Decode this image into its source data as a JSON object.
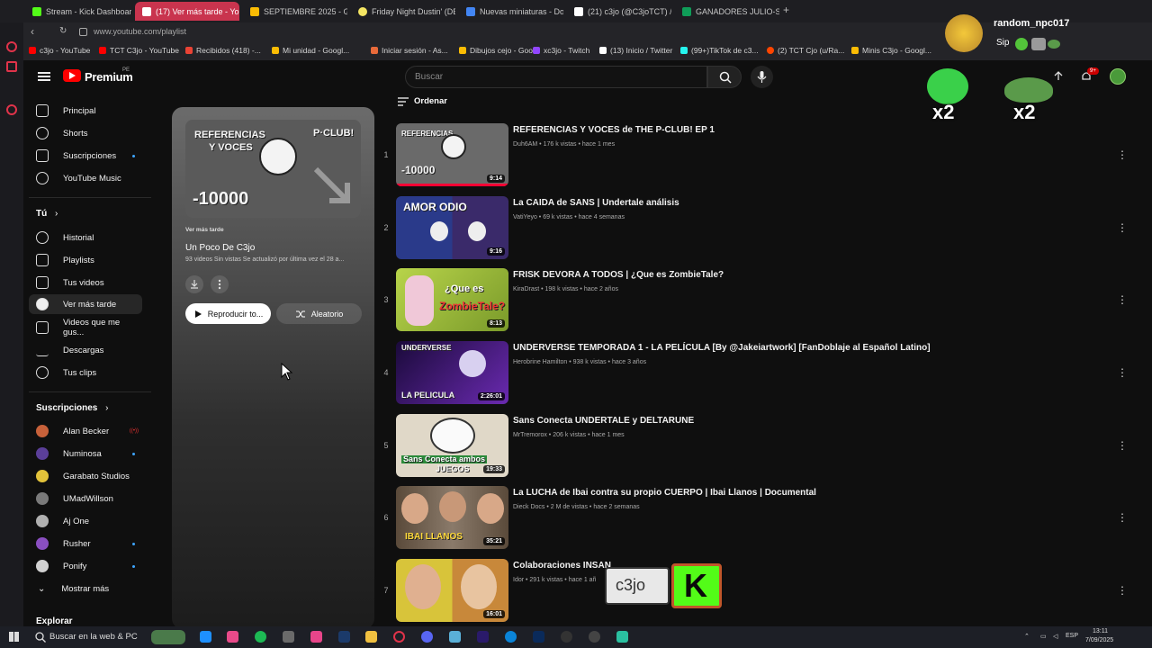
{
  "browser": {
    "tabs": [
      {
        "label": "Stream - Kick Dashboard",
        "color": "#53fc18"
      },
      {
        "label": "(17) Ver más tarde - YouT",
        "color": "#ffffff",
        "active": true
      },
      {
        "label": "SEPTIEMBRE 2025 - Goo",
        "color": "#fbbc04"
      },
      {
        "label": "Friday Night Dustin' (DEM",
        "color": "#f5e663"
      },
      {
        "label": "Nuevas miniaturas - Docu",
        "color": "#4285f4"
      },
      {
        "label": "(21) c3jo (@C3joTCT) / X",
        "color": "#ffffff"
      },
      {
        "label": "GANADORES JULIO-SET",
        "color": "#0f9d58"
      }
    ],
    "new_tab": "+",
    "address": "www.youtube.com/playlist",
    "bookmarks": [
      "c3jo - YouTube",
      "TCT C3jo - YouTube",
      "Recibidos (418) -...",
      "Mi unidad - Googl...",
      "Iniciar sesión - As...",
      "Dibujos cejo - Goo...",
      "xc3jo - Twitch",
      "(13) Inicio / Twitter",
      "(99+)TikTok de c3...",
      "(2) TCT Cjo (u/Ra...",
      "Minis C3jo - Googl..."
    ]
  },
  "youtube": {
    "brand": "Premium",
    "country": "PE",
    "search_placeholder": "Buscar",
    "sidebar": {
      "main": [
        "Principal",
        "Shorts",
        "Suscripciones",
        "YouTube Music"
      ],
      "you_heading": "Tú",
      "you": [
        "Historial",
        "Playlists",
        "Tus videos",
        "Ver más tarde",
        "Videos que me gus...",
        "Descargas",
        "Tus clips"
      ],
      "subs_heading": "Suscripciones",
      "subs": [
        {
          "name": "Alan Becker",
          "color": "#c7613a",
          "badge": "live"
        },
        {
          "name": "Numinosa",
          "color": "#5b3f99",
          "badge": "dot"
        },
        {
          "name": "Garabato Studios",
          "color": "#e2c23a",
          "badge": ""
        },
        {
          "name": "UMadWillson",
          "color": "#7a7a7a",
          "badge": ""
        },
        {
          "name": "Aj One",
          "color": "#b0b0b0",
          "badge": ""
        },
        {
          "name": "Rusher",
          "color": "#8a4fc1",
          "badge": "dot"
        },
        {
          "name": "Ponify",
          "color": "#d2d2d2",
          "badge": "dot"
        }
      ],
      "show_more": "Mostrar más",
      "explore_heading": "Explorar"
    },
    "playlist": {
      "label": "Ver más tarde",
      "title": "Un Poco De C3jo",
      "meta": "93 videos  Sin vistas  Se actualizó por última vez el 28 a...",
      "play_all": "Reproducir to...",
      "shuffle": "Aleatorio",
      "thumb_text_1": "REFERENCIAS",
      "thumb_text_2": "Y VOCES",
      "thumb_text_3": "-10000",
      "thumb_text_4": "P·CLUB!"
    },
    "sort_label": "Ordenar",
    "videos": [
      {
        "index": "1",
        "title": "REFERENCIAS Y VOCES de THE P-CLUB! EP 1",
        "meta": "Duh6AM  •  176 k vistas  •  hace 1 mes",
        "duration": "9:14",
        "bg": "#6a6a6a"
      },
      {
        "index": "2",
        "title": "La CAIDA de SANS | Undertale análisis",
        "meta": "VatiYeyo  •  69 k vistas  •  hace 4 semanas",
        "duration": "9:16",
        "bg": "#2a3a8a"
      },
      {
        "index": "3",
        "title": "FRISK DEVORA A TODOS | ¿Que es ZombieTale?",
        "meta": "KiraDrast  •  198 k vistas  •  hace 2 años",
        "duration": "8:13",
        "bg": "#a8c23a"
      },
      {
        "index": "4",
        "title": "UNDERVERSE TEMPORADA 1 - LA PELÍCULA [By @Jakeiartwork] [FanDoblaje al Español Latino]",
        "meta": "Herobrine Hamilton  •  938 k vistas  •  hace 3 años",
        "duration": "2:26:01",
        "bg": "#3a1a6a"
      },
      {
        "index": "5",
        "title": "Sans Conecta UNDERTALE y DELTARUNE",
        "meta": "MrTremorox  •  206 k vistas  •  hace 1 mes",
        "duration": "19:33",
        "bg": "#d8d0c0"
      },
      {
        "index": "6",
        "title": "La LUCHA de Ibai contra su propio CUERPO | Ibai Llanos | Documental",
        "meta": "Dieck Docs  •  2 M de vistas  •  hace 2 semanas",
        "duration": "35:21",
        "bg": "#7a6a5a"
      },
      {
        "index": "7",
        "title": "Colaboraciones INSAN",
        "meta": "Idor  •  291 k vistas  •  hace 1 añ",
        "duration": "16:01",
        "bg": "#d8a83a"
      }
    ],
    "notification_count": "9+"
  },
  "stream_overlay": {
    "user": "random_npc017",
    "message": "Sip",
    "multiplier_1": "x2",
    "multiplier_2": "x2",
    "badge_text": "c3jo",
    "badge_logo": "K"
  },
  "taskbar": {
    "search": "Buscar en la web & PC",
    "lang": "ESP",
    "time": "13:11",
    "date": "7/09/2025"
  },
  "colors": {
    "accent": "#ff0000",
    "opera": "#e0334a",
    "kick": "#53fc18"
  }
}
